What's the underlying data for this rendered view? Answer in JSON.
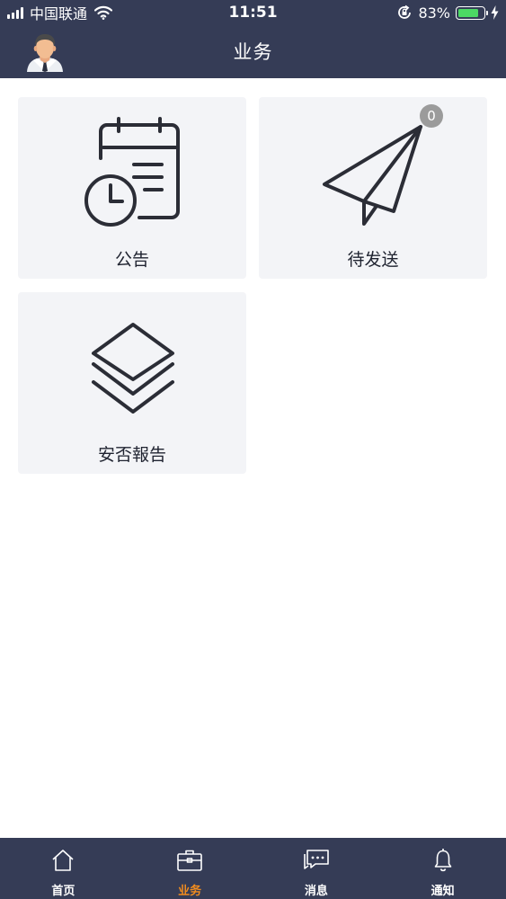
{
  "status_bar": {
    "carrier": "中国联通",
    "time": "11:51",
    "battery": "83%",
    "battery_level": 0.83,
    "battery_color": "#4cd964"
  },
  "header": {
    "title": "业务",
    "background": "#353c56",
    "avatar_icon": "user-avatar"
  },
  "tiles": [
    {
      "label": "公告",
      "icon": "calendar-clock-icon"
    },
    {
      "label": "待发送",
      "icon": "paper-plane-icon",
      "badge": "0"
    },
    {
      "label": "安否報告",
      "icon": "layers-icon"
    }
  ],
  "tabbar": {
    "accent": "#f28c1e",
    "items": [
      {
        "label": "首页",
        "icon": "home-icon",
        "active": false
      },
      {
        "label": "业务",
        "icon": "briefcase-icon",
        "active": true
      },
      {
        "label": "消息",
        "icon": "chat-icon",
        "active": false
      },
      {
        "label": "通知",
        "icon": "bell-icon",
        "active": false
      }
    ]
  }
}
